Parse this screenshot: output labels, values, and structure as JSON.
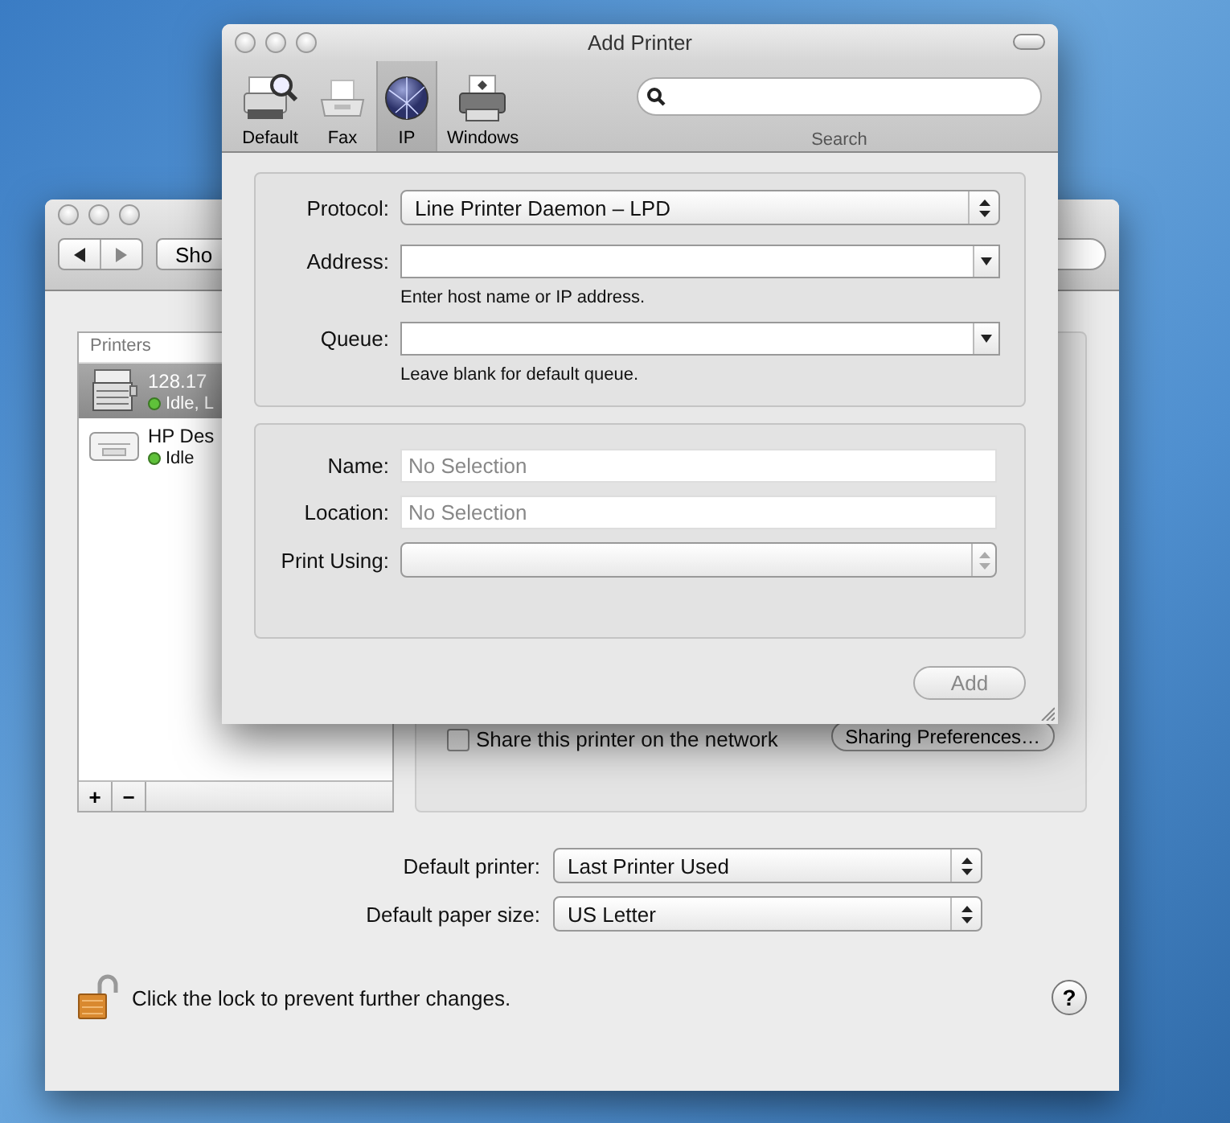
{
  "back_window": {
    "show_button": "Sho",
    "printers": {
      "header": "Printers",
      "items": [
        {
          "name": "128.17",
          "status": "Idle, L",
          "selected": true,
          "kind": "laser"
        },
        {
          "name": "HP Des",
          "status": "Idle",
          "selected": false,
          "kind": "desktop"
        }
      ]
    },
    "list_buttons": [
      "+",
      "−"
    ],
    "share": {
      "label": "Share this printer on the network",
      "checked": false
    },
    "sharing_button": "Sharing Preferences…",
    "defaults": [
      {
        "label": "Default printer:",
        "value": "Last Printer Used"
      },
      {
        "label": "Default paper size:",
        "value": "US Letter"
      }
    ],
    "lock_text": "Click the lock to prevent further changes.",
    "help": "?"
  },
  "front_window": {
    "title": "Add Printer",
    "toolbar": [
      {
        "label": "Default",
        "kind": "default",
        "selected": false
      },
      {
        "label": "Fax",
        "kind": "fax",
        "selected": false
      },
      {
        "label": "IP",
        "kind": "ip",
        "selected": true
      },
      {
        "label": "Windows",
        "kind": "windows",
        "selected": false
      }
    ],
    "search": {
      "label": "Search"
    },
    "protocol": {
      "label": "Protocol:",
      "value": "Line Printer Daemon – LPD"
    },
    "address": {
      "label": "Address:",
      "hint": "Enter host name or IP address."
    },
    "queue": {
      "label": "Queue:",
      "hint": "Leave blank for default queue."
    },
    "name": {
      "label": "Name:",
      "placeholder": "No Selection"
    },
    "location": {
      "label": "Location:",
      "placeholder": "No Selection"
    },
    "print_using": {
      "label": "Print Using:",
      "disabled": true
    },
    "add_button": {
      "label": "Add",
      "disabled": true
    }
  }
}
